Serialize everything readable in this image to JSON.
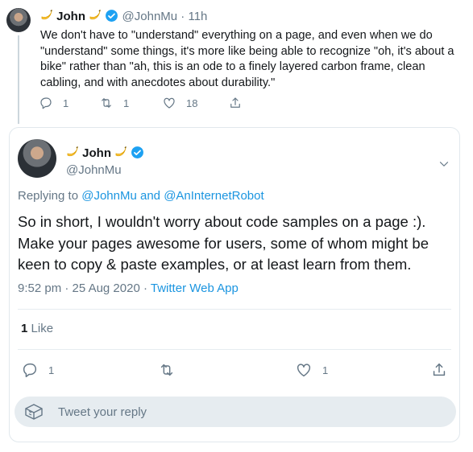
{
  "parent_tweet": {
    "name": "John",
    "handle": "@JohnMu",
    "separator": "·",
    "time": "11h",
    "text": "We don't have to \"understand\" everything on a page, and even when we do \"understand\" some things, it's more like being able to recognize \"oh, it's about a bike\" rather than \"ah, this is an ode to a finely layered carbon frame, clean cabling, and with anecdotes about durability.\"",
    "reply_count": "1",
    "retweet_count": "1",
    "like_count": "18"
  },
  "focal_tweet": {
    "name": "John",
    "handle": "@JohnMu",
    "replying_prefix": "Replying to",
    "reply_user_1": "@JohnMu",
    "reply_and": "and",
    "reply_user_2": "@AnInternetRobot",
    "text": "So in short, I wouldn't worry about code samples on a page :). Make your pages awesome for users, some of whom might be keen to copy & paste examples, or at least learn from them.",
    "time": "9:52 pm",
    "meta_sep": "·",
    "date": "25 Aug 2020",
    "source": "Twitter Web App",
    "likes_count": "1",
    "likes_label": "Like",
    "reply_count": "1",
    "like_count": "1"
  },
  "reply_box": {
    "placeholder": "Tweet your reply"
  },
  "icons": {
    "verified": "verified-badge-icon",
    "banana": "banana-emoji-icon",
    "reply": "reply-icon",
    "retweet": "retweet-icon",
    "like": "heart-icon",
    "share": "share-icon",
    "more": "chevron-down-icon",
    "gif": "gif-icon"
  },
  "colors": {
    "accent": "#1da1f2",
    "link": "#1b95e0",
    "muted": "#657786",
    "banana": "#ffcc4d"
  }
}
